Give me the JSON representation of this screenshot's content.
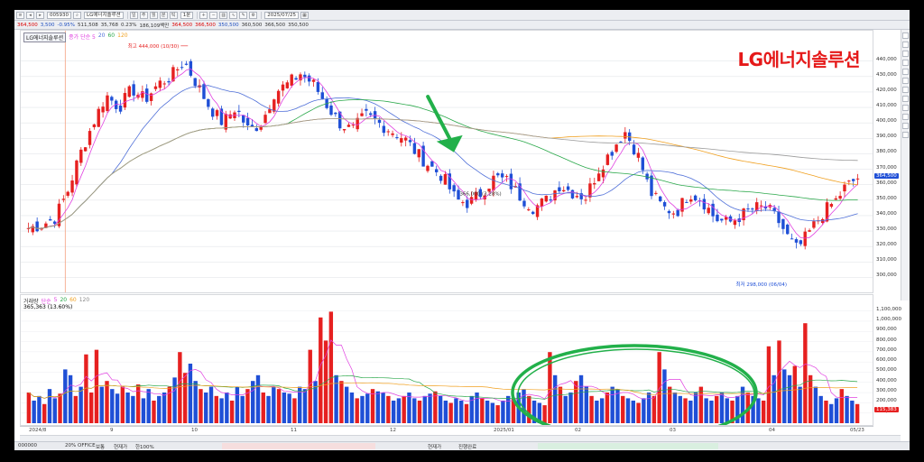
{
  "window": {
    "toolbar_fields": [
      "005930",
      "LG에너지솔루션",
      "1분",
      "2025/07/25"
    ],
    "info_row": [
      {
        "text": "364,500",
        "color": "red"
      },
      {
        "text": "3,500",
        "color": "blue"
      },
      {
        "text": "-0.95%",
        "color": "blue"
      },
      {
        "text": "511,508",
        "color": "black"
      },
      {
        "text": "35,768",
        "color": "black"
      },
      {
        "text": "0.23%",
        "color": "black"
      },
      {
        "text": "186,109백만",
        "color": "black"
      },
      {
        "text": "364,500",
        "color": "red"
      },
      {
        "text": "366,500",
        "color": "red"
      },
      {
        "text": "350,500",
        "color": "blue"
      },
      {
        "text": "360,500",
        "color": "black"
      },
      {
        "text": "366,500",
        "color": "black"
      },
      {
        "text": "350,500",
        "color": "black"
      }
    ]
  },
  "price_pane": {
    "name_box": "LG에너지솔루션",
    "ma_labels": [
      {
        "text": "종가 단순 5",
        "color": "#e040e0"
      },
      {
        "text": "20",
        "color": "#4f6fd8"
      },
      {
        "text": "60",
        "color": "#2aa84a"
      },
      {
        "text": "120",
        "color": "#f0a020"
      }
    ],
    "stock_name": "LG에너지솔루션",
    "high_label": "최고 444,000 (10/30)",
    "low_label": "최저 298,000 (06/04)",
    "mid_label": "366,000 (3.28%)",
    "current_price_tag": "364,500"
  },
  "volume_pane": {
    "labels": [
      {
        "text": "거래량",
        "color": "#333"
      },
      {
        "text": "단순",
        "color": "#e040e0"
      },
      {
        "text": "5",
        "color": "#e040e0"
      },
      {
        "text": "20",
        "color": "#2aa84a"
      },
      {
        "text": "60",
        "color": "#f0a020"
      },
      {
        "text": "120",
        "color": "#888"
      }
    ],
    "value_line": "365,363 (13.60%)",
    "current_tag": "115,383"
  },
  "x_axis": {
    "labels": [
      "2024/8",
      "9",
      "10",
      "11",
      "12",
      "2025/01",
      "02",
      "03",
      "04",
      "05/23"
    ]
  },
  "statusbar": {
    "items": [
      "000000",
      "20%",
      "OFFICE",
      "보통",
      "현재가",
      "한100%",
      "보통",
      "현재가",
      "100%",
      "현재가",
      "진행완료"
    ]
  },
  "chart_data": {
    "type": "candlestick",
    "title": "",
    "ylim": [
      295000,
      455000
    ],
    "y_ticks": [
      300000,
      310000,
      320000,
      330000,
      340000,
      350000,
      360000,
      370000,
      380000,
      390000,
      400000,
      410000,
      420000,
      430000,
      440000
    ],
    "y_tick_labels": [
      "300,000",
      "310,000",
      "320,000",
      "330,000",
      "340,000",
      "350,000",
      "360,000",
      "370,000",
      "380,000",
      "390,000",
      "400,000",
      "410,000",
      "420,000",
      "430,000",
      "440,000"
    ],
    "volume_ylim": [
      0,
      1150000
    ],
    "volume_ticks": [
      100000,
      200000,
      300000,
      400000,
      500000,
      600000,
      700000,
      800000,
      900000,
      1000000,
      1100000
    ],
    "volume_tick_labels": [
      "100,000",
      "200,000",
      "300,000",
      "400,000",
      "500,000",
      "600,000",
      "700,000",
      "800,000",
      "900,000",
      "1,000,000",
      "1,100,000"
    ],
    "price_path": [
      [
        0,
        332000
      ],
      [
        6,
        334000
      ],
      [
        12,
        338000
      ],
      [
        18,
        355000
      ],
      [
        24,
        380000
      ],
      [
        30,
        400000
      ],
      [
        36,
        418000
      ],
      [
        42,
        410000
      ],
      [
        48,
        422000
      ],
      [
        54,
        415000
      ],
      [
        60,
        425000
      ],
      [
        66,
        430000
      ],
      [
        72,
        440000
      ],
      [
        78,
        425000
      ],
      [
        84,
        410000
      ],
      [
        90,
        400000
      ],
      [
        96,
        410000
      ],
      [
        102,
        395000
      ],
      [
        108,
        400000
      ],
      [
        114,
        420000
      ],
      [
        120,
        425000
      ],
      [
        126,
        432000
      ],
      [
        132,
        425000
      ],
      [
        138,
        412000
      ],
      [
        144,
        400000
      ],
      [
        150,
        395000
      ],
      [
        156,
        405000
      ],
      [
        162,
        400000
      ],
      [
        168,
        395000
      ],
      [
        174,
        390000
      ],
      [
        180,
        380000
      ],
      [
        186,
        372000
      ],
      [
        192,
        365000
      ],
      [
        198,
        350000
      ],
      [
        204,
        348000
      ],
      [
        210,
        355000
      ],
      [
        216,
        365000
      ],
      [
        222,
        362000
      ],
      [
        228,
        352000
      ],
      [
        234,
        345000
      ],
      [
        240,
        350000
      ],
      [
        246,
        360000
      ],
      [
        252,
        355000
      ],
      [
        258,
        352000
      ],
      [
        264,
        370000
      ],
      [
        270,
        382000
      ],
      [
        276,
        395000
      ],
      [
        282,
        380000
      ],
      [
        288,
        355000
      ],
      [
        294,
        345000
      ],
      [
        300,
        342000
      ],
      [
        306,
        355000
      ],
      [
        312,
        350000
      ],
      [
        318,
        338000
      ],
      [
        324,
        335000
      ],
      [
        330,
        340000
      ],
      [
        336,
        345000
      ],
      [
        342,
        345000
      ],
      [
        348,
        335000
      ],
      [
        352,
        325000
      ],
      [
        356,
        318000
      ],
      [
        362,
        330000
      ],
      [
        368,
        342000
      ],
      [
        374,
        350000
      ],
      [
        378,
        358000
      ],
      [
        384,
        364500
      ]
    ],
    "volume_heights": [
      0.25,
      0.18,
      0.22,
      0.15,
      0.28,
      0.2,
      0.24,
      0.45,
      0.4,
      0.22,
      0.3,
      0.58,
      0.25,
      0.62,
      0.3,
      0.35,
      0.28,
      0.24,
      0.3,
      0.25,
      0.22,
      0.32,
      0.2,
      0.28,
      0.18,
      0.22,
      0.25,
      0.3,
      0.38,
      0.6,
      0.42,
      0.5,
      0.35,
      0.28,
      0.25,
      0.3,
      0.22,
      0.2,
      0.25,
      0.18,
      0.3,
      0.22,
      0.28,
      0.35,
      0.4,
      0.25,
      0.22,
      0.3,
      0.28,
      0.25,
      0.24,
      0.2,
      0.3,
      0.28,
      0.62,
      0.35,
      0.9,
      0.7,
      0.95,
      0.4,
      0.35,
      0.3,
      0.25,
      0.2,
      0.22,
      0.24,
      0.28,
      0.26,
      0.25,
      0.22,
      0.18,
      0.2,
      0.22,
      0.25,
      0.2,
      0.18,
      0.22,
      0.24,
      0.26,
      0.22,
      0.18,
      0.16,
      0.2,
      0.18,
      0.15,
      0.22,
      0.25,
      0.2,
      0.18,
      0.16,
      0.14,
      0.18,
      0.22,
      0.2,
      0.25,
      0.28,
      0.22,
      0.18,
      0.16,
      0.14,
      0.6,
      0.4,
      0.3,
      0.22,
      0.25,
      0.35,
      0.4,
      0.3,
      0.22,
      0.18,
      0.2,
      0.25,
      0.3,
      0.28,
      0.22,
      0.2,
      0.18,
      0.16,
      0.2,
      0.25,
      0.22,
      0.6,
      0.45,
      0.3,
      0.25,
      0.22,
      0.2,
      0.18,
      0.25,
      0.3,
      0.2,
      0.18,
      0.22,
      0.25,
      0.2,
      0.18,
      0.22,
      0.3,
      0.25,
      0.22,
      0.2,
      0.18,
      0.65,
      0.4,
      0.7,
      0.45,
      0.4,
      0.48,
      0.3,
      0.85,
      0.4,
      0.3,
      0.22,
      0.18,
      0.15,
      0.2,
      0.28,
      0.22,
      0.18,
      0.15
    ],
    "annotation": {
      "type": "green-ellipse",
      "note": "volume region highlight"
    }
  }
}
